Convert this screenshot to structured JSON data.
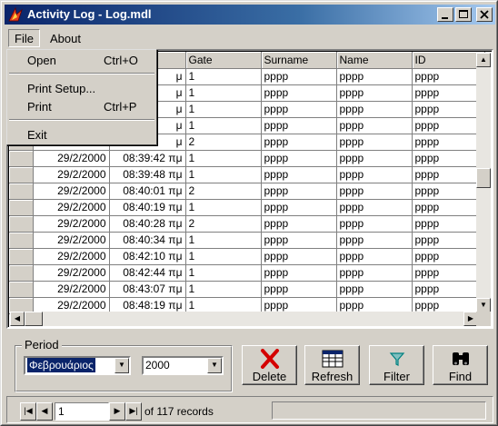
{
  "window": {
    "title": "Activity Log - Log.mdl"
  },
  "menubar": {
    "file": "File",
    "about": "About"
  },
  "file_menu": {
    "items": [
      {
        "label": "Open",
        "shortcut": "Ctrl+O"
      },
      {
        "label": "Print Setup...",
        "shortcut": ""
      },
      {
        "label": "Print",
        "shortcut": "Ctrl+P"
      },
      {
        "label": "Exit",
        "shortcut": ""
      }
    ]
  },
  "grid": {
    "columns": [
      "",
      "",
      "",
      "Gate",
      "Surname",
      "Name",
      "ID"
    ],
    "rows": [
      {
        "date": "",
        "time": "μ",
        "gate": "1",
        "surname": "pppp",
        "name": "pppp",
        "id": "pppp"
      },
      {
        "date": "",
        "time": "μ",
        "gate": "1",
        "surname": "pppp",
        "name": "pppp",
        "id": "pppp"
      },
      {
        "date": "",
        "time": "μ",
        "gate": "1",
        "surname": "pppp",
        "name": "pppp",
        "id": "pppp"
      },
      {
        "date": "",
        "time": "μ",
        "gate": "1",
        "surname": "pppp",
        "name": "pppp",
        "id": "pppp"
      },
      {
        "date": "",
        "time": "μ",
        "gate": "2",
        "surname": "pppp",
        "name": "pppp",
        "id": "pppp"
      },
      {
        "date": "29/2/2000",
        "time": "08:39:42 πμ",
        "gate": "1",
        "surname": "pppp",
        "name": "pppp",
        "id": "pppp"
      },
      {
        "date": "29/2/2000",
        "time": "08:39:48 πμ",
        "gate": "1",
        "surname": "pppp",
        "name": "pppp",
        "id": "pppp"
      },
      {
        "date": "29/2/2000",
        "time": "08:40:01 πμ",
        "gate": "2",
        "surname": "pppp",
        "name": "pppp",
        "id": "pppp"
      },
      {
        "date": "29/2/2000",
        "time": "08:40:19 πμ",
        "gate": "1",
        "surname": "pppp",
        "name": "pppp",
        "id": "pppp"
      },
      {
        "date": "29/2/2000",
        "time": "08:40:28 πμ",
        "gate": "2",
        "surname": "pppp",
        "name": "pppp",
        "id": "pppp"
      },
      {
        "date": "29/2/2000",
        "time": "08:40:34 πμ",
        "gate": "1",
        "surname": "pppp",
        "name": "pppp",
        "id": "pppp"
      },
      {
        "date": "29/2/2000",
        "time": "08:42:10 πμ",
        "gate": "1",
        "surname": "pppp",
        "name": "pppp",
        "id": "pppp"
      },
      {
        "date": "29/2/2000",
        "time": "08:42:44 πμ",
        "gate": "1",
        "surname": "pppp",
        "name": "pppp",
        "id": "pppp"
      },
      {
        "date": "29/2/2000",
        "time": "08:43:07 πμ",
        "gate": "1",
        "surname": "pppp",
        "name": "pppp",
        "id": "pppp"
      },
      {
        "date": "29/2/2000",
        "time": "08:48:19 πμ",
        "gate": "1",
        "surname": "pppp",
        "name": "pppp",
        "id": "pppp"
      }
    ]
  },
  "period": {
    "label": "Period",
    "month": "Φεβρουάριος",
    "year": "2000"
  },
  "toolbar": {
    "delete": "Delete",
    "refresh": "Refresh",
    "filter": "Filter",
    "find": "Find",
    "delete_color": "#d40000",
    "filter_color": "#008080"
  },
  "navigator": {
    "current": "1",
    "records_text": "of 117 records"
  },
  "icons": {
    "minimize": "minimize-icon",
    "maximize": "maximize-icon",
    "close": "close-icon",
    "delete": "red-x-icon",
    "refresh": "table-grid-icon",
    "filter": "funnel-icon",
    "find": "binoculars-icon"
  }
}
